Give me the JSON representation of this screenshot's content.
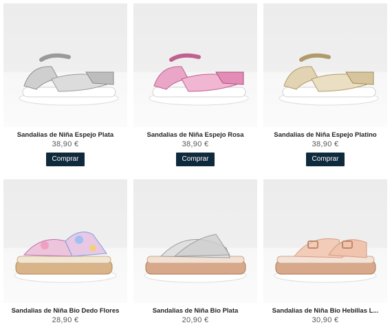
{
  "products": [
    {
      "name": "Sandalias de Niña Espejo Plata",
      "price": "38,90 €",
      "button": "Comprar",
      "color": "#cfcfcf",
      "accent": "#9a9a9a"
    },
    {
      "name": "Sandalias de Niña Espejo Rosa",
      "price": "38,90 €",
      "button": "Comprar",
      "color": "#e9a2c4",
      "accent": "#c0608f"
    },
    {
      "name": "Sandalias de Niña Espejo Platino",
      "price": "38,90 €",
      "button": "Comprar",
      "color": "#e0d2b0",
      "accent": "#b09a6a"
    },
    {
      "name": "Sandalias de Niña Bio Dedo Flores",
      "price": "28,90 €",
      "color": "#e8c0d8",
      "accent": "#7aa0d8"
    },
    {
      "name": "Sandalias de Niña Bio Plata",
      "price": "20,90 €",
      "color": "#d8d8d8",
      "accent": "#a8a8a8"
    },
    {
      "name": "Sandalias de Niña Bio Hebillas L...",
      "price": "30,90 €",
      "color": "#f0c8b4",
      "accent": "#d49a82"
    }
  ]
}
